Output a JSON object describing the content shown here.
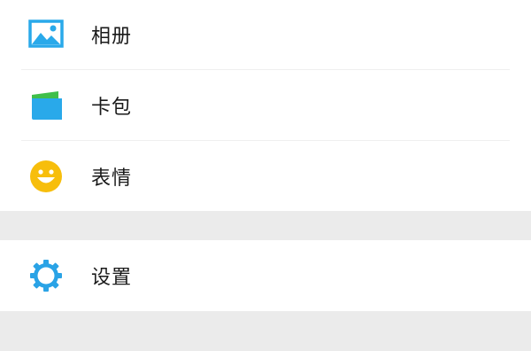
{
  "menu_groups": [
    {
      "items": [
        {
          "label": "相册",
          "icon": "photo-album-icon",
          "icon_color": "#29a9ea"
        },
        {
          "label": "卡包",
          "icon": "card-wallet-icon",
          "icon_color": "#29a9ea"
        },
        {
          "label": "表情",
          "icon": "emoji-smile-icon",
          "icon_color": "#f7be0c"
        }
      ]
    },
    {
      "items": [
        {
          "label": "设置",
          "icon": "settings-gear-icon",
          "icon_color": "#2aa3e6"
        }
      ]
    }
  ],
  "colors": {
    "background": "#ebebeb",
    "card": "#ffffff",
    "divider": "#efefef",
    "text": "#1a1a1a"
  }
}
